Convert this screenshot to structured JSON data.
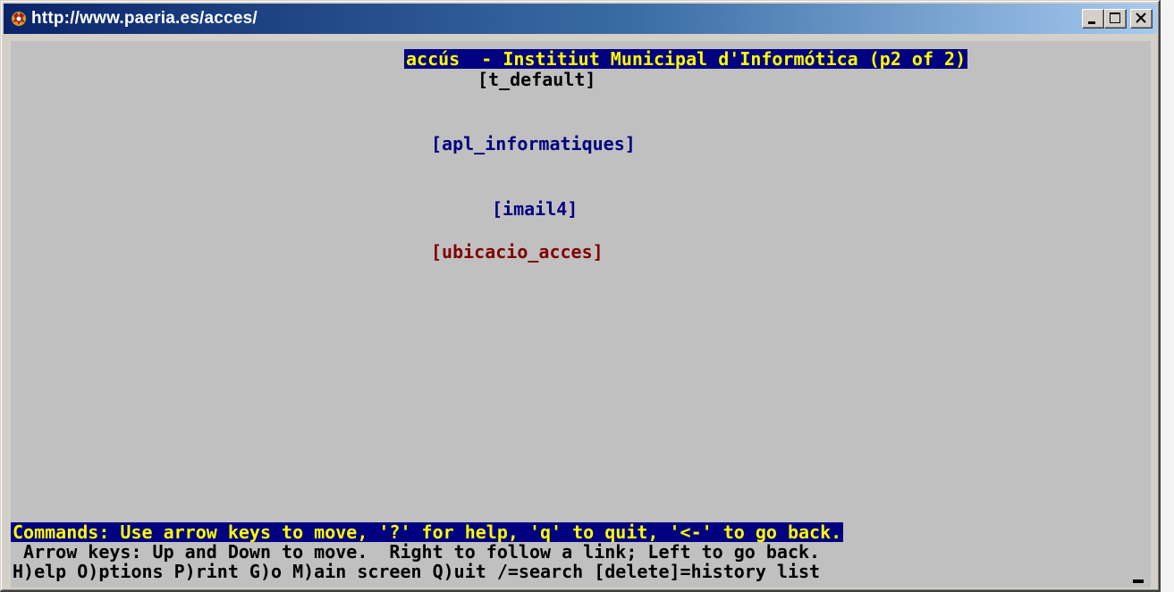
{
  "window": {
    "title": "http://www.paeria.es/acces/",
    "controls": {
      "minimize": "minimize-icon",
      "maximize": "maximize-icon",
      "close": "close-icon"
    }
  },
  "page": {
    "header_line": "accús  - Institiut Municipal d'Informótica (p2 of 2)",
    "items": [
      {
        "text": "[t_default]",
        "type": "image-placeholder"
      },
      {
        "text": "[apl_informatiques]",
        "type": "link"
      },
      {
        "text": "[imail4]",
        "type": "link"
      },
      {
        "text": "[ubicacio_acces]",
        "type": "link-selected"
      }
    ]
  },
  "status": {
    "commands": "Commands: Use arrow keys to move, '?' for help, 'q' to quit, '<-' to go back.",
    "help_line": " Arrow keys: Up and Down to move.  Right to follow a link; Left to go back.",
    "menu_line": "H)elp O)ptions P)rint G)o M)ain screen Q)uit /=search [delete]=history list"
  },
  "colors": {
    "background": "#c0c0c0",
    "highlight_bg": "#000080",
    "highlight_fg": "#ffff00",
    "link": "#000080",
    "selected_link": "#800000"
  }
}
